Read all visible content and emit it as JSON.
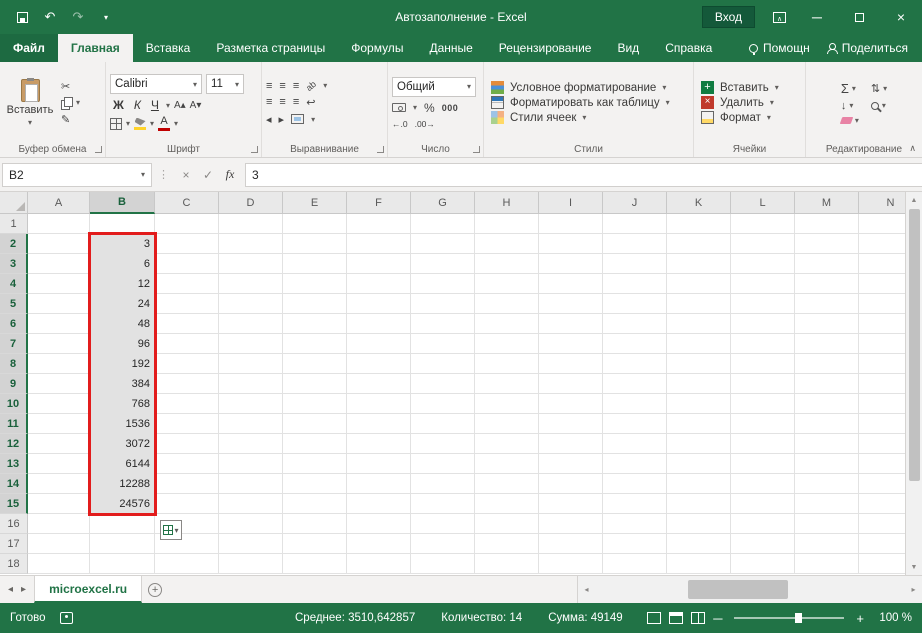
{
  "icons": {
    "dropdown": "▾",
    "scissors": "✂",
    "format_painter": "✎",
    "undo": "↶",
    "redo": "↷",
    "close": "×",
    "minimize": "─",
    "check": "✓",
    "cancel": "×",
    "fx": "fx",
    "sum": "Σ",
    "fill": "↓",
    "sort": "⇅",
    "align": "≡",
    "wrap": "↩",
    "orientation": "ab",
    "up_triangle": "▲",
    "down_triangle": "▼",
    "left_tri": "◂",
    "right_tri": "▸",
    "plus": "+",
    "collapse": "∧",
    "dots": "⋮",
    "increase_decimal": "←.0",
    "decrease_decimal": ".00→",
    "font_up": "А▴",
    "font_down": "А▾",
    "font_color_letter": "А",
    "percent": "%"
  },
  "titlebar": {
    "title": "Автозаполнение - Excel",
    "signin": "Вход"
  },
  "tabs": {
    "file": "Файл",
    "items": [
      "Главная",
      "Вставка",
      "Разметка страницы",
      "Формулы",
      "Данные",
      "Рецензирование",
      "Вид",
      "Справка"
    ],
    "assistant": "Помощн",
    "share": "Поделиться"
  },
  "ribbon": {
    "paste": "Вставить",
    "clipboard_group": "Буфер обмена",
    "font_name": "Calibri",
    "font_size": "11",
    "bold": "Ж",
    "italic": "К",
    "underline": "Ч",
    "font_group": "Шрифт",
    "align_group": "Выравнивание",
    "number_format": "Общий",
    "thousands": "000",
    "number_group": "Число",
    "cond_format": "Условное форматирование",
    "format_table": "Форматировать как таблицу",
    "cell_styles": "Стили ячеек",
    "styles_group": "Стили",
    "insert": "Вставить",
    "delete": "Удалить",
    "format": "Формат",
    "cells_group": "Ячейки",
    "editing_group": "Редактирование"
  },
  "formula_bar": {
    "name_box": "B2",
    "value": "3"
  },
  "grid": {
    "columns": [
      "A",
      "B",
      "C",
      "D",
      "E",
      "F",
      "G",
      "H",
      "I",
      "J",
      "K",
      "L",
      "M",
      "N"
    ],
    "row_count": 18,
    "selected_column": "B",
    "b_start_row": 2,
    "b_values": [
      "3",
      "6",
      "12",
      "24",
      "48",
      "96",
      "192",
      "384",
      "768",
      "1536",
      "3072",
      "6144",
      "12288",
      "24576"
    ]
  },
  "sheet": {
    "tab": "microexcel.ru"
  },
  "statusbar": {
    "ready": "Готово",
    "average": "Среднее: 3510,642857",
    "count": "Количество: 14",
    "sum": "Сумма: 49149",
    "zoom": "100 %"
  },
  "colors": {
    "accent_green": "#217346",
    "selection_border_red": "#e21c1c",
    "selected_fill": "#e2e2e2",
    "header_fill": "#e9e9e9"
  }
}
